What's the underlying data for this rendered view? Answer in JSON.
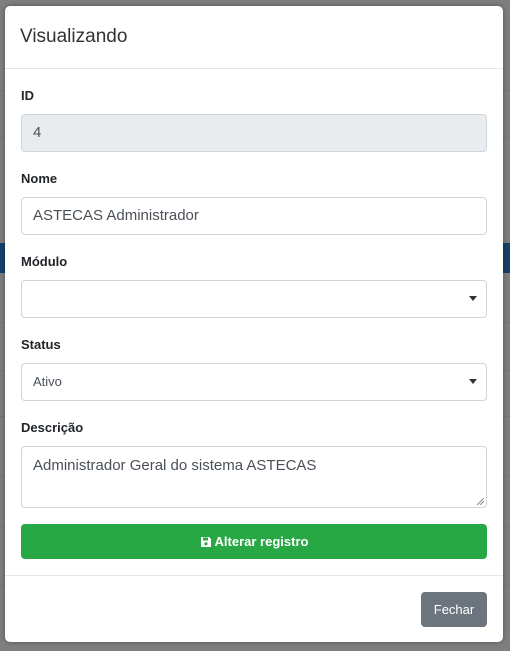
{
  "modal": {
    "title": "Visualizando"
  },
  "form": {
    "id": {
      "label": "ID",
      "value": "4"
    },
    "nome": {
      "label": "Nome",
      "value": "ASTECAS Administrador"
    },
    "modulo": {
      "label": "Módulo",
      "value": ""
    },
    "status": {
      "label": "Status",
      "value": "Ativo"
    },
    "descricao": {
      "label": "Descrição",
      "value": "Administrador Geral do sistema ASTECAS"
    }
  },
  "actions": {
    "save_label": "Alterar registro",
    "close_label": "Fechar"
  },
  "colors": {
    "save_button": "#28a745",
    "close_button": "#6c757d",
    "background_header_band": "#16406b"
  },
  "icons": {
    "save": "floppy-disk-icon",
    "select_caret": "caret-down-icon"
  }
}
